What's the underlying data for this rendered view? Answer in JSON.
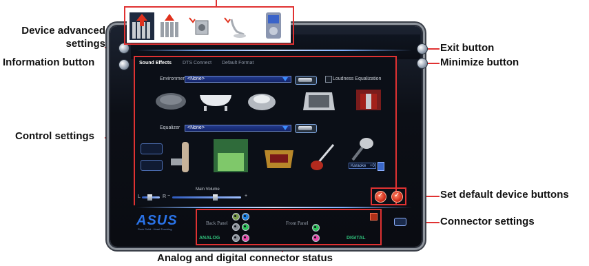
{
  "callouts": {
    "device_advanced_settings": "Device advanced\nsettings",
    "information_button": "Information button",
    "control_settings": "Control settings",
    "exit_button": "Exit button",
    "minimize_button": "Minimize button",
    "set_default_device_buttons": "Set default device buttons",
    "connector_settings": "Connector settings",
    "connector_status": "Analog and digital connector status"
  },
  "tabs": [
    "Sound Effects",
    "DTS Connect",
    "Default Format"
  ],
  "environment": {
    "label": "Environment",
    "value": "<None>",
    "loudness_label": "Loudness Equalization"
  },
  "equalizer": {
    "label": "Equalizer",
    "value": "<None>",
    "karaoke_label": "Karaoke",
    "karaoke_value": "+0"
  },
  "volume": {
    "label": "Main Volume",
    "left": "L",
    "right": "R",
    "minus": "−",
    "plus": "+",
    "level": 0.62
  },
  "connectors": {
    "back_panel": "Back Panel",
    "front_panel": "Front Panel",
    "analog": "ANALOG",
    "digital": "DIGITAL",
    "jack_colors": [
      "#7a9c4a",
      "#1e7fdc",
      "#8a8f97",
      "#2fbf5a",
      "#8a8f97",
      "#e64aa8"
    ]
  },
  "brand": {
    "logo": "ASUS",
    "tagline": "Rock Solid · Heart Touching"
  },
  "colors": {
    "callout_line": "#e03232",
    "accent_blue": "#2a73e8"
  }
}
